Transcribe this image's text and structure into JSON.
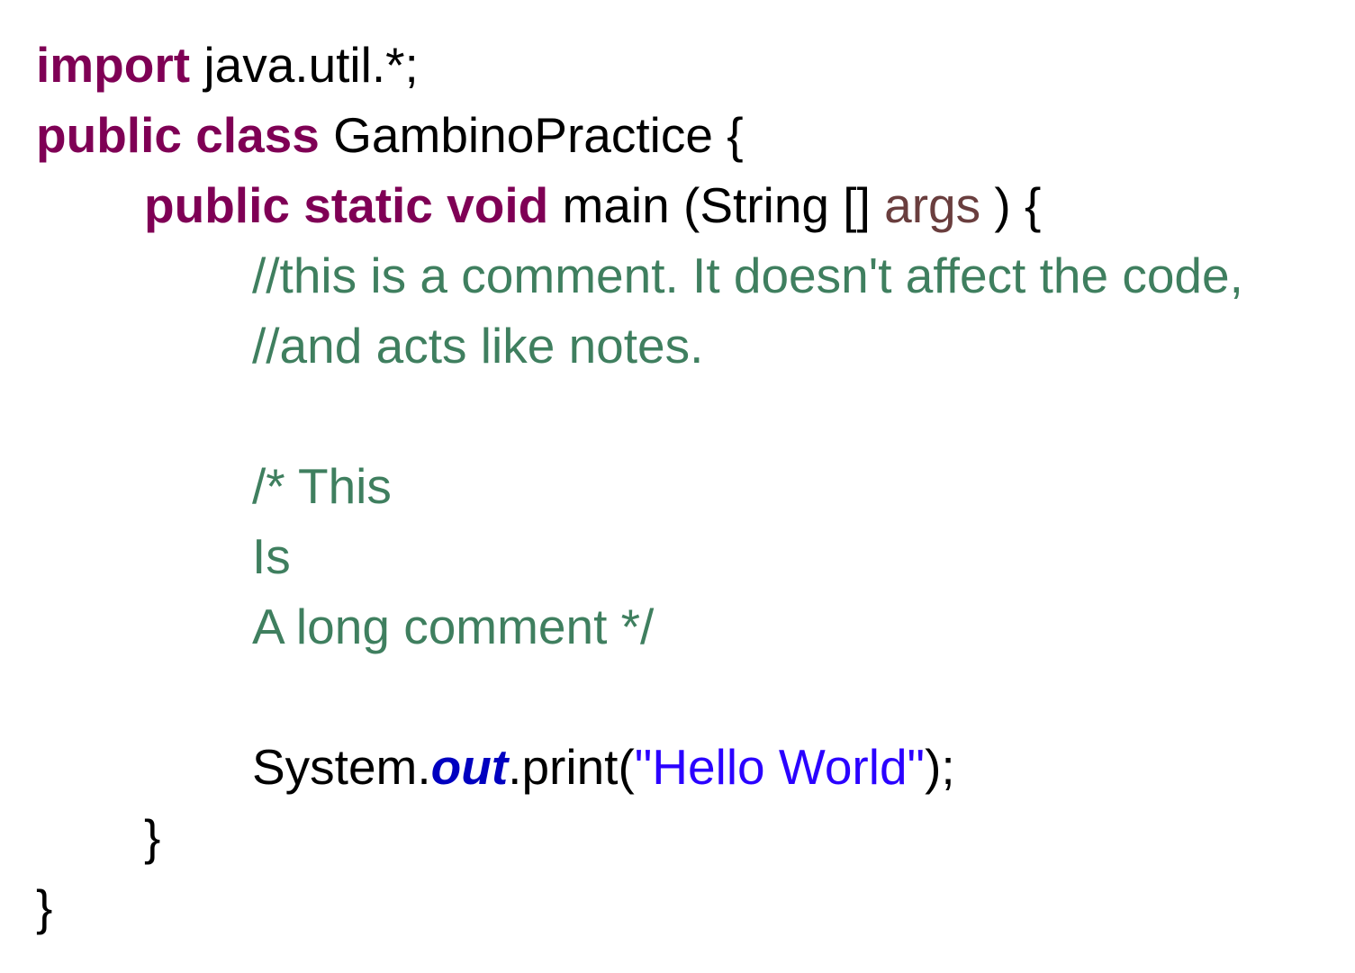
{
  "code": {
    "colors": {
      "keyword": "#7f0055",
      "plain": "#000000",
      "param": "#6a3e3e",
      "comment": "#3f7f5f",
      "field": "#0000c0",
      "string": "#2a00ff"
    },
    "line1": {
      "kw": "import",
      "rest": " java.util.*;"
    },
    "line2": {
      "kw": "public class",
      "rest": " GambinoPractice {"
    },
    "line3": {
      "kw": "public static void",
      "pre": " main (String [] ",
      "param": "args",
      "post": " ) {"
    },
    "line4": {
      "comment": "//this is a comment. It doesn't affect the code,"
    },
    "line5": {
      "comment": "//and acts like notes."
    },
    "line7": {
      "comment": "/* This"
    },
    "line8": {
      "comment": "Is"
    },
    "line9": {
      "comment": "A long comment */"
    },
    "line11": {
      "pre": "System.",
      "field": "out",
      "mid": ".print(",
      "string": "\"Hello World\"",
      "post": ");"
    },
    "line12": {
      "text": "}"
    },
    "line13": {
      "text": "}"
    }
  }
}
